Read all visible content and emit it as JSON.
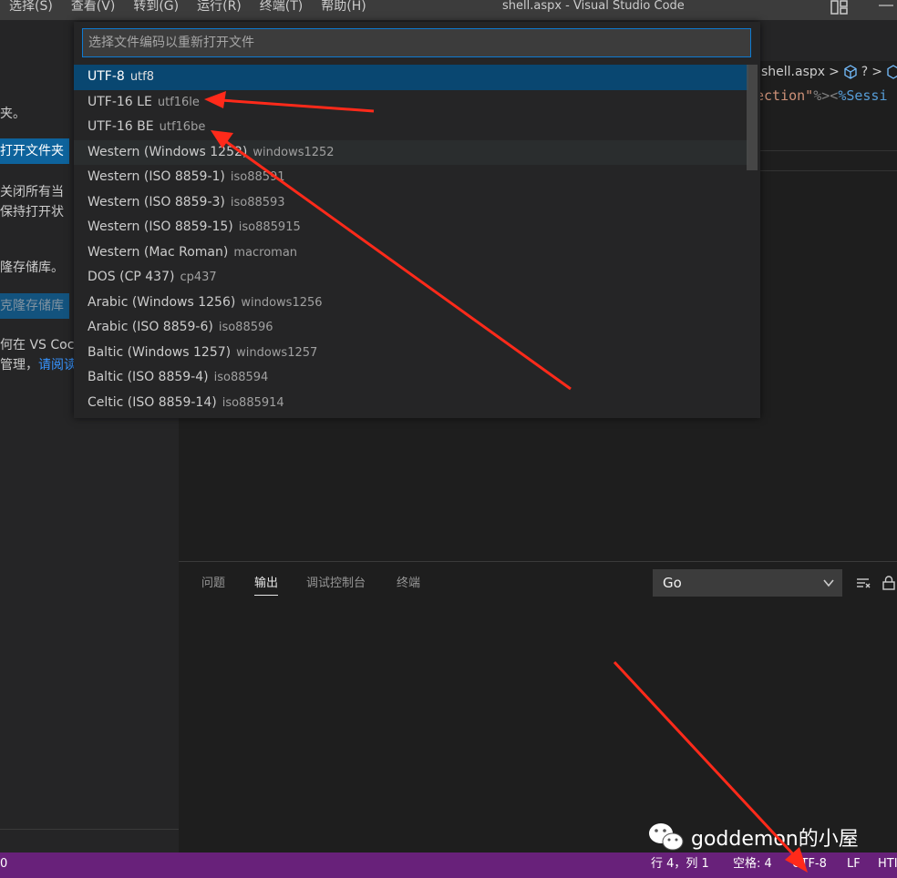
{
  "menubar": {
    "items": [
      "选择(S)",
      "查看(V)",
      "转到(G)",
      "运行(R)",
      "终端(T)",
      "帮助(H)"
    ],
    "window_title": "shell.aspx - Visual Studio Code"
  },
  "sidebar": {
    "line1": "夹。",
    "open_folder_button": "打开文件夹",
    "line2": "关闭所有当",
    "line3": "保持打开状",
    "line4": "隆存储库。",
    "clone_button": "克隆存储库",
    "line5": "何在 VS Coc",
    "line6_prefix": "管理，",
    "line6_link": "请阅读"
  },
  "editor": {
    "breadcrumb_file": "shell.aspx",
    "breadcrumb_sep": ">",
    "breadcrumb_symbol": "?",
    "code_a": "ection\"",
    "code_b": "%>",
    "code_c": "<",
    "code_d": "%Sessi"
  },
  "quickpick": {
    "placeholder": "选择文件编码以重新打开文件",
    "items": [
      {
        "label": "UTF-8",
        "desc": "utf8"
      },
      {
        "label": "UTF-16 LE",
        "desc": "utf16le"
      },
      {
        "label": "UTF-16 BE",
        "desc": "utf16be"
      },
      {
        "label": "Western (Windows 1252)",
        "desc": "windows1252"
      },
      {
        "label": "Western (ISO 8859-1)",
        "desc": "iso88591"
      },
      {
        "label": "Western (ISO 8859-3)",
        "desc": "iso88593"
      },
      {
        "label": "Western (ISO 8859-15)",
        "desc": "iso885915"
      },
      {
        "label": "Western (Mac Roman)",
        "desc": "macroman"
      },
      {
        "label": "DOS (CP 437)",
        "desc": "cp437"
      },
      {
        "label": "Arabic (Windows 1256)",
        "desc": "windows1256"
      },
      {
        "label": "Arabic (ISO 8859-6)",
        "desc": "iso88596"
      },
      {
        "label": "Baltic (Windows 1257)",
        "desc": "windows1257"
      },
      {
        "label": "Baltic (ISO 8859-4)",
        "desc": "iso88594"
      },
      {
        "label": "Celtic (ISO 8859-14)",
        "desc": "iso885914"
      }
    ]
  },
  "panel": {
    "tabs": [
      "问题",
      "输出",
      "调试控制台",
      "终端"
    ],
    "active_tab": "输出",
    "output_select": "Go"
  },
  "statusbar": {
    "left": "0",
    "position": "行 4，列 1",
    "spaces": "空格: 4",
    "encoding": "UTF-8",
    "eol": "LF",
    "language": "HTI"
  },
  "watermark": {
    "text": "goddemon的小屋"
  },
  "colors": {
    "statusbar": "#68217a",
    "selection": "#094771",
    "accent_button": "#0e639c",
    "annotation_arrow": "#ff2a1a"
  }
}
